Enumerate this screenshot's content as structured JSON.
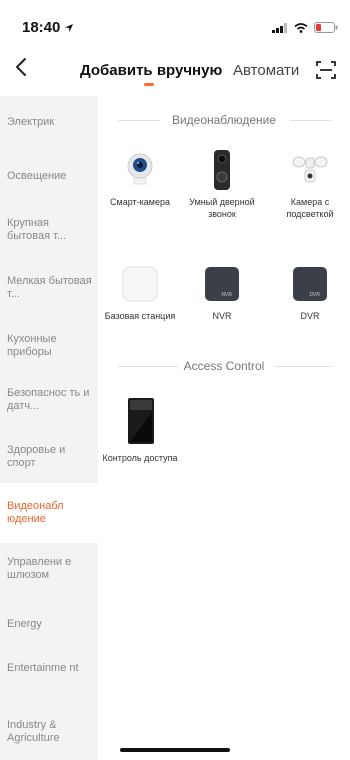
{
  "status": {
    "time": "18:40"
  },
  "nav": {
    "tab_manual": "Добавить вручную",
    "tab_auto": "Автомати"
  },
  "sidebar": {
    "items": [
      {
        "label": "Электрик"
      },
      {
        "label": "Освещение"
      },
      {
        "label": "Крупная бытовая т..."
      },
      {
        "label": "Мелкая бытовая т..."
      },
      {
        "label": "Кухонные приборы"
      },
      {
        "label": "Безопаснос ть и датч..."
      },
      {
        "label": "Здоровье и спорт"
      },
      {
        "label": "Видеонабл юдение"
      },
      {
        "label": "Управлени е шлюзом"
      },
      {
        "label": "Energy"
      },
      {
        "label": "Entertainme nt"
      },
      {
        "label": "Industry & Agriculture"
      }
    ]
  },
  "main": {
    "section1_title": "Видеонаблюдение",
    "section2_title": "Access Control",
    "devices": [
      {
        "label": "Смарт-камера",
        "icon": "smart-camera-icon"
      },
      {
        "label": "Умный дверной звонок",
        "icon": "doorbell-icon"
      },
      {
        "label": "Камера с подсветкой",
        "icon": "floodlight-camera-icon"
      },
      {
        "label": "Базовая станция",
        "icon": "base-station-icon"
      },
      {
        "label": "NVR",
        "icon": "nvr-icon"
      },
      {
        "label": "DVR",
        "icon": "dvr-icon"
      },
      {
        "label": "Контроль доступа",
        "icon": "access-control-icon"
      }
    ],
    "nvr_badge": "NVR",
    "dvr_badge": "DVR"
  },
  "colors": {
    "accent": "#e8642a",
    "sidebar_bg": "#f3f3f3"
  }
}
